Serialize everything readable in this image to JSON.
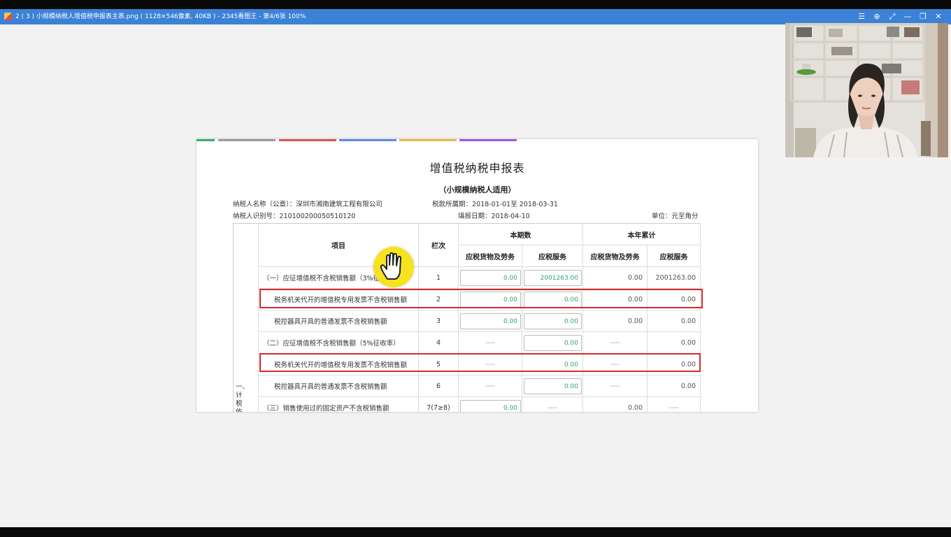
{
  "window": {
    "title": "2 ( 3 ) 小规模纳税人增值税申报表主表.png ( 1128×546像素, 40KB ) - 2345看图王 - 第4/6张 100%",
    "buttons": [
      "☰",
      "⊕",
      "⤢",
      "—",
      "❐",
      "✕"
    ]
  },
  "form": {
    "title": "增值税纳税申报表",
    "subtitle": "（小规模纳税人适用）",
    "taxpayer_name": "纳税人名称（公章）：深圳市湘南建筑工程有限公司",
    "period": "税款所属期：2018-01-01至 2018-03-31",
    "taxpayer_id": "纳税人识别号：210100200050510120",
    "fill_date": "填报日期：2018-04-10",
    "unit": "单位：元至角分",
    "headers": {
      "item": "项目",
      "col_no": "栏次",
      "current": "本期数",
      "ytd": "本年累计",
      "goods": "应税货物及劳务",
      "services": "应税服务"
    },
    "side_label": "一、计税依据",
    "rows": [
      {
        "item": "（一）应征增值税不含税销售额（3%征收",
        "no": "1",
        "c_goods": "0.00",
        "c_services": "2001263.00",
        "y_goods": "0.00",
        "y_services": "2001263.00"
      },
      {
        "item": "税务机关代开的增值税专用发票不含税销售额",
        "no": "2",
        "c_goods": "0.00",
        "c_services": "0.00",
        "y_goods": "0.00",
        "y_services": "0.00"
      },
      {
        "item": "税控器具开具的普通发票不含税销售额",
        "no": "3",
        "c_goods": "0.00",
        "c_services": "0.00",
        "y_goods": "0.00",
        "y_services": "0.00"
      },
      {
        "item": "（二）应征增值税不含税销售额（5%征收率）",
        "no": "4",
        "c_goods": "----",
        "c_services": "0.00",
        "y_goods": "----",
        "y_services": "0.00"
      },
      {
        "item": "税务机关代开的增值税专用发票不含税销售额",
        "no": "5",
        "c_goods": "----",
        "c_services": "0.00",
        "y_goods": "----",
        "y_services": "0.00"
      },
      {
        "item": "税控器具开具的普通发票不含税销售额",
        "no": "6",
        "c_goods": "----",
        "c_services": "0.00",
        "y_goods": "----",
        "y_services": "0.00"
      },
      {
        "item": "（三）销售使用过的固定资产不含税销售额",
        "no": "7(7≥8)",
        "c_goods": "0.00",
        "c_services": "----",
        "y_goods": "0.00",
        "y_services": "----"
      }
    ]
  },
  "colors": {
    "titlebar": "#3b82d6",
    "input_text": "#2fa46a",
    "highlight": "#d22b2b",
    "cursor": "#f7e21e"
  }
}
